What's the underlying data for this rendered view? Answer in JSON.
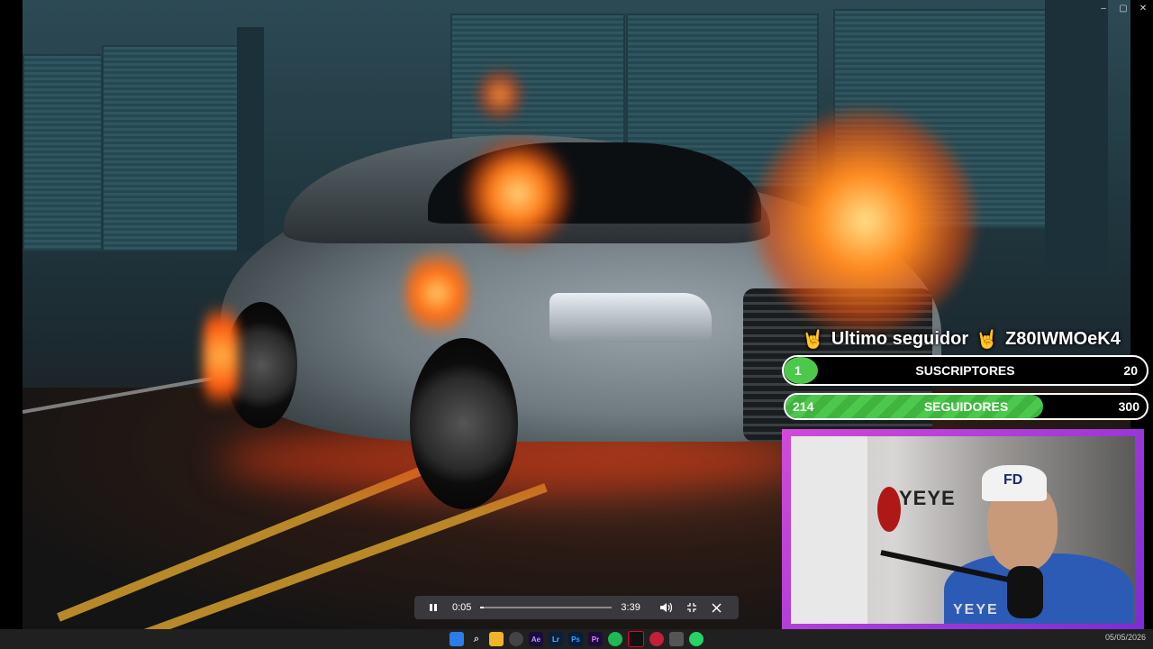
{
  "window": {
    "controls": [
      "–",
      "▢",
      "✕"
    ]
  },
  "overlay": {
    "last_follower_label": "Ultimo seguidor",
    "last_follower_name": "Z80IWMOeK4",
    "subscribers": {
      "label": "SUSCRIPTORES",
      "current": "1",
      "goal": "20",
      "progress": 0.05
    },
    "followers": {
      "label": "SEGUIDORES",
      "current": "214",
      "goal": "300",
      "progress": 0.713
    },
    "hand_icon": "rock-hand-icon",
    "accent_color": "#4cc94c",
    "frame_color": "#c64ad6"
  },
  "webcam": {
    "wall_text": "YEYE",
    "cap_logo": "FD",
    "name_plate": "YEYE"
  },
  "player": {
    "elapsed": "0:05",
    "duration": "3:39",
    "progress": 0.023,
    "play_state_icon": "pause-icon"
  },
  "taskbar": {
    "icons": [
      "windows-start-icon",
      "search-icon",
      "file-explorer-icon",
      "obs-icon",
      "after-effects-icon",
      "lightroom-icon",
      "photoshop-icon",
      "premiere-icon",
      "spotify-icon",
      "tiktok-icon",
      "app-icon",
      "app-icon",
      "whatsapp-icon"
    ],
    "icon_labels": [
      "",
      "",
      "",
      "",
      "Ae",
      "Lr",
      "Ps",
      "Pr",
      "",
      "",
      "",
      "",
      ""
    ],
    "clock": "05/05/2026"
  }
}
